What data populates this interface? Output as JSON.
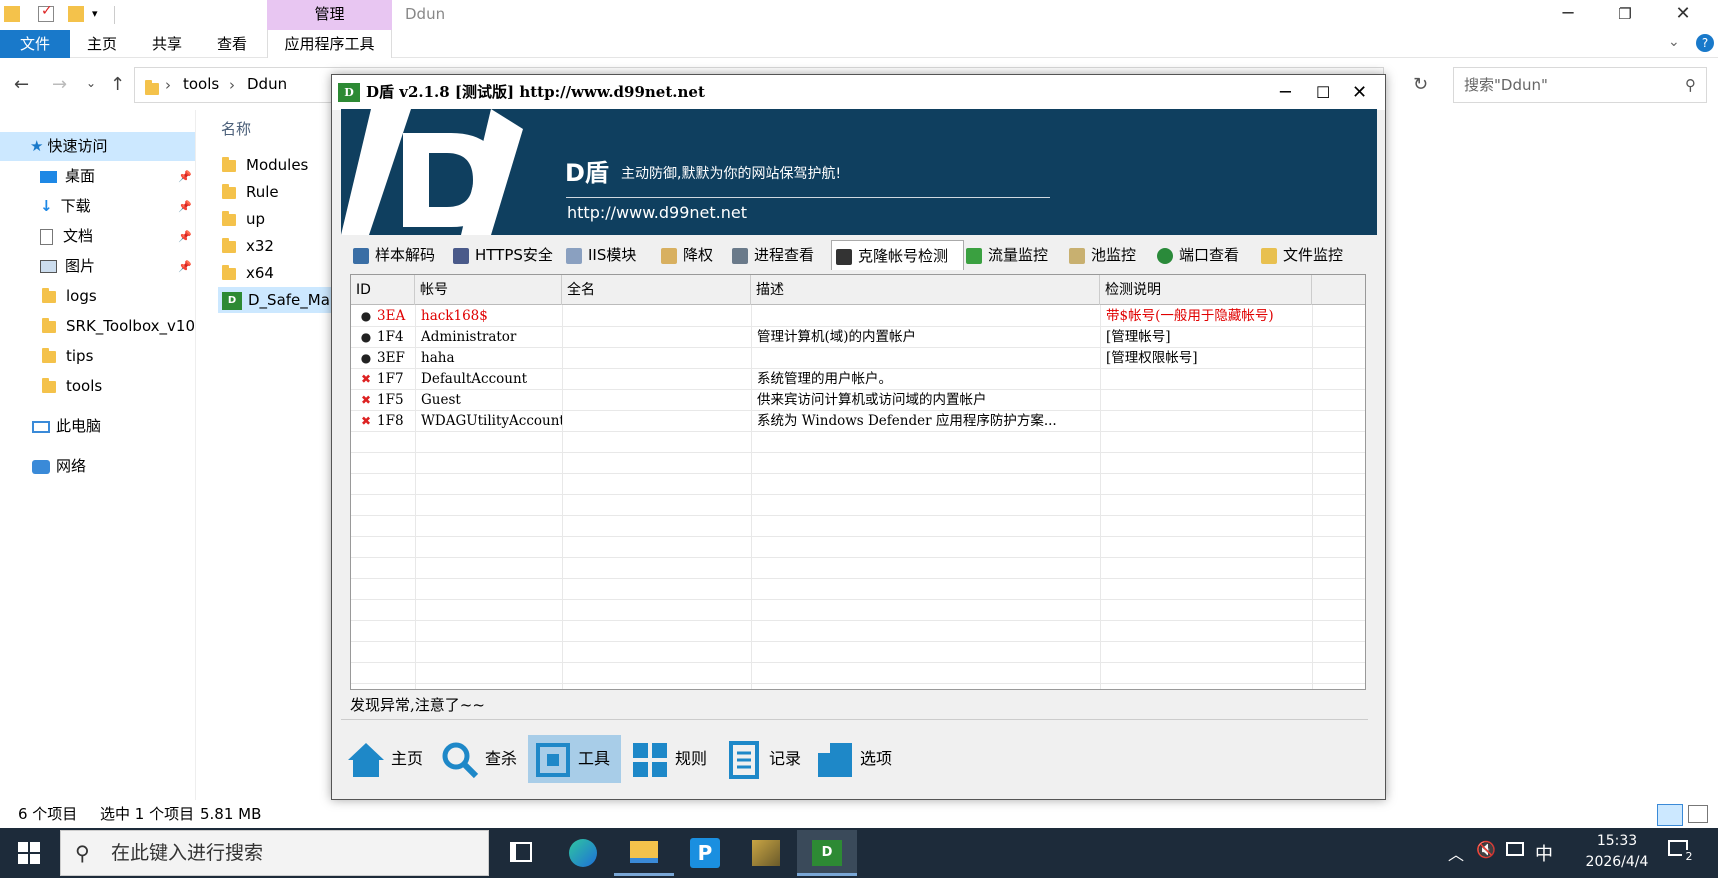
{
  "explorer": {
    "ribbon_context_label": "管理",
    "window_title": "Ddun",
    "ribbon_tabs": [
      "文件",
      "主页",
      "共享",
      "查看",
      "应用程序工具"
    ],
    "breadcrumb": [
      "tools",
      "Ddun"
    ],
    "search_placeholder": "搜索\"Ddun\"",
    "column_header": "名称",
    "nav_items": [
      {
        "label": "快速访问",
        "icon": "star-icon"
      },
      {
        "label": "桌面",
        "icon": "desktop-icon",
        "pinned": true
      },
      {
        "label": "下载",
        "icon": "download-icon",
        "pinned": true
      },
      {
        "label": "文档",
        "icon": "document-icon",
        "pinned": true
      },
      {
        "label": "图片",
        "icon": "picture-icon",
        "pinned": true
      },
      {
        "label": "logs",
        "icon": "folder-icon"
      },
      {
        "label": "SRK_Toolbox_v10",
        "icon": "folder-icon"
      },
      {
        "label": "tips",
        "icon": "folder-icon"
      },
      {
        "label": "tools",
        "icon": "folder-icon"
      },
      {
        "label": "此电脑",
        "icon": "computer-icon"
      },
      {
        "label": "网络",
        "icon": "network-icon"
      }
    ],
    "files": [
      {
        "name": "Modules",
        "type": "folder"
      },
      {
        "name": "Rule",
        "type": "folder"
      },
      {
        "name": "up",
        "type": "folder"
      },
      {
        "name": "x32",
        "type": "folder"
      },
      {
        "name": "x64",
        "type": "folder"
      },
      {
        "name": "D_Safe_Mar",
        "type": "app",
        "selected": true
      }
    ],
    "status": {
      "count": "6 个项目",
      "selection": "选中 1 个项目",
      "size": "5.81 MB"
    }
  },
  "dshield": {
    "title": "D盾 v2.1.8 [测试版] http://www.d99net.net",
    "banner": {
      "brand": "D盾",
      "slogan": "主动防御,默默为你的网站保驾护航!",
      "url": "http://www.d99net.net"
    },
    "tabs": [
      {
        "label": "样本解码",
        "icon": "decode-icon",
        "color": "#3a6ea5"
      },
      {
        "label": "HTTPS安全",
        "icon": "https-icon",
        "color": "#4a5a8a"
      },
      {
        "label": "IIS模块",
        "icon": "iis-icon",
        "color": "#8aa0c0"
      },
      {
        "label": "降权",
        "icon": "downgrade-icon",
        "color": "#d8b060"
      },
      {
        "label": "进程查看",
        "icon": "process-icon",
        "color": "#6a7a8a"
      },
      {
        "label": "克隆帐号检测",
        "icon": "clone-account-icon",
        "color": "#333333",
        "active": true
      },
      {
        "label": "流量监控",
        "icon": "traffic-icon",
        "color": "#3aa040"
      },
      {
        "label": "池监控",
        "icon": "pool-icon",
        "color": "#c8b070"
      },
      {
        "label": "端口查看",
        "icon": "port-icon",
        "color": "#2a8a3a"
      },
      {
        "label": "文件监控",
        "icon": "file-monitor-icon",
        "color": "#e8c050"
      }
    ],
    "grid": {
      "columns": [
        "ID",
        "帐号",
        "全名",
        "描述",
        "检测说明"
      ],
      "rows": [
        {
          "icon": "user-icon",
          "id": "3EA",
          "account": "hack168$",
          "fullname": "",
          "desc": "",
          "note": "带$帐号(一般用于隐藏帐号)",
          "alert": true
        },
        {
          "icon": "user-icon",
          "id": "1F4",
          "account": "Administrator",
          "fullname": "",
          "desc": "管理计算机(域)的内置帐户",
          "note": "[管理帐号]",
          "alert": false
        },
        {
          "icon": "user-icon",
          "id": "3EF",
          "account": "haha",
          "fullname": "",
          "desc": "",
          "note": "[管理权限帐号]",
          "alert": false
        },
        {
          "icon": "disabled-icon",
          "id": "1F7",
          "account": "DefaultAccount",
          "fullname": "",
          "desc": "系统管理的用户帐户。",
          "note": "",
          "alert": false
        },
        {
          "icon": "disabled-icon",
          "id": "1F5",
          "account": "Guest",
          "fullname": "",
          "desc": "供来宾访问计算机或访问域的内置帐户",
          "note": "",
          "alert": false
        },
        {
          "icon": "disabled-icon",
          "id": "1F8",
          "account": "WDAGUtilityAccount",
          "fullname": "",
          "desc": "系统为 Windows Defender 应用程序防护方案...",
          "note": "",
          "alert": false
        }
      ]
    },
    "status_message": "发现异常,注意了~~",
    "bottom_buttons": [
      {
        "label": "主页",
        "icon": "home-icon"
      },
      {
        "label": "查杀",
        "icon": "scan-icon"
      },
      {
        "label": "工具",
        "icon": "tools-icon",
        "active": true
      },
      {
        "label": "规则",
        "icon": "rules-icon"
      },
      {
        "label": "记录",
        "icon": "log-icon"
      },
      {
        "label": "选项",
        "icon": "options-icon"
      }
    ]
  },
  "taskbar": {
    "search_placeholder": "在此键入进行搜索",
    "ime": "中",
    "time": "15:33",
    "date": "2026/4/4",
    "notification_count": "2"
  },
  "colors": {
    "accent": "#1979ca",
    "banner": "#0f3f5f",
    "alert": "#e00000",
    "active_button": "#a8cde8"
  }
}
